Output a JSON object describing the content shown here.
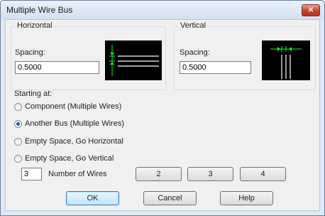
{
  "window": {
    "title": "Multiple Wire Bus",
    "close_glyph": "✕"
  },
  "horizontal": {
    "label": "Horizontal",
    "spacing_label": "Spacing:",
    "spacing_value": "0.5000"
  },
  "vertical": {
    "label": "Vertical",
    "spacing_label": "Spacing:",
    "spacing_value": "0.5000"
  },
  "starting_at": {
    "label": "Starting at:",
    "options": [
      {
        "label": "Component (Multiple Wires)",
        "selected": false
      },
      {
        "label": "Another Bus (Multiple Wires)",
        "selected": true
      },
      {
        "label": "Empty Space, Go Horizontal",
        "selected": false
      },
      {
        "label": "Empty Space, Go Vertical",
        "selected": false
      }
    ]
  },
  "wires": {
    "count_value": "3",
    "count_label": "Number of Wires",
    "presets": [
      "2",
      "3",
      "4"
    ]
  },
  "footer": {
    "ok": "OK",
    "cancel": "Cancel",
    "help": "Help"
  },
  "colors": {
    "preview_background": "#000000",
    "preview_lines": "#ffffff",
    "preview_marker": "#00ff33"
  }
}
